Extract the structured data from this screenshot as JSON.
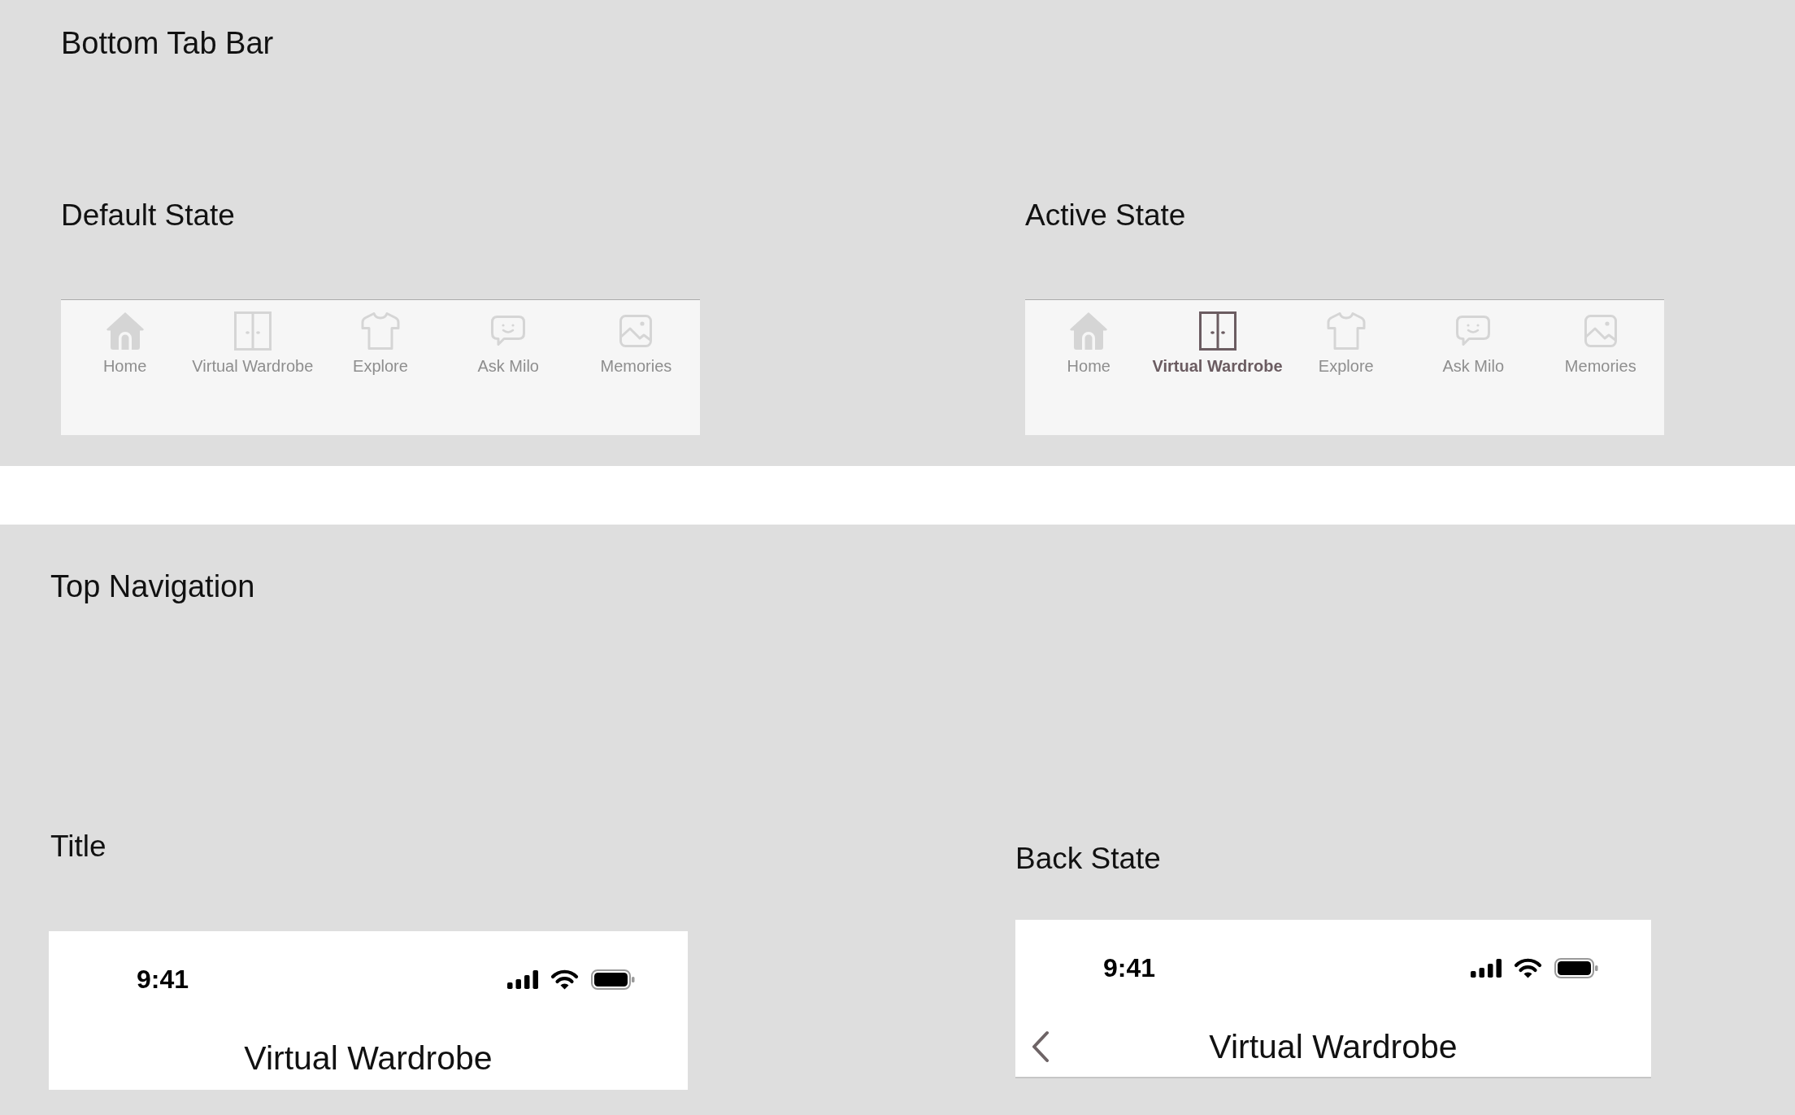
{
  "bottom_tab_bar": {
    "title": "Bottom Tab Bar",
    "variants": [
      {
        "label": "Default State",
        "tabs": [
          {
            "label": "Home",
            "selected": false
          },
          {
            "label": "Virtual Wardrobe",
            "selected": false
          },
          {
            "label": "Explore",
            "selected": false
          },
          {
            "label": "Ask Milo",
            "selected": false
          },
          {
            "label": "Memories",
            "selected": false
          }
        ]
      },
      {
        "label": "Active State",
        "tabs": [
          {
            "label": "Home",
            "selected": false
          },
          {
            "label": "Virtual Wardrobe",
            "selected": true
          },
          {
            "label": "Explore",
            "selected": false
          },
          {
            "label": "Ask Milo",
            "selected": false
          },
          {
            "label": "Memories",
            "selected": false
          }
        ]
      }
    ]
  },
  "top_navigation": {
    "title": "Top Navigation",
    "variants": [
      {
        "label": "Title",
        "status_bar": {
          "time": "9:41"
        },
        "back_button": false,
        "title": "Virtual Wardrobe"
      },
      {
        "label": "Back State",
        "status_bar": {
          "time": "9:41"
        },
        "back_button": true,
        "title": "Virtual Wardrobe"
      }
    ]
  }
}
